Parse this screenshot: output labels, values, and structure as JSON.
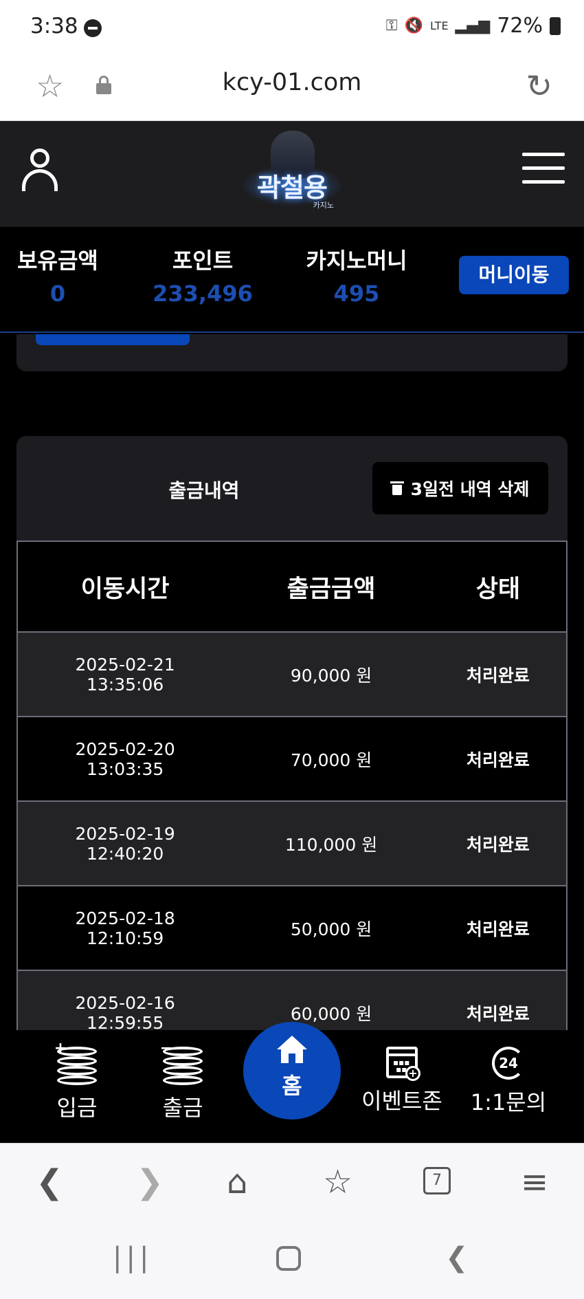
{
  "statusbar": {
    "time": "3:38",
    "battery": "72%",
    "lte": "LTE"
  },
  "browser": {
    "url": "kcy-01.com",
    "tab_count": "7"
  },
  "header": {
    "logo_text": "곽철용",
    "logo_sub": "카지노"
  },
  "balance": {
    "held_label": "보유금액",
    "held_value": "0",
    "points_label": "포인트",
    "points_value": "233,496",
    "casino_label": "카지노머니",
    "casino_value": "495",
    "transfer_button": "머니이동"
  },
  "history": {
    "title": "출금내역",
    "delete_button": "3일전 내역 삭제",
    "columns": [
      "이동시간",
      "출금금액",
      "상태"
    ],
    "rows": [
      {
        "date": "2025-02-21",
        "time": "13:35:06",
        "amount": "90,000 원",
        "status": "처리완료"
      },
      {
        "date": "2025-02-20",
        "time": "13:03:35",
        "amount": "70,000 원",
        "status": "처리완료"
      },
      {
        "date": "2025-02-19",
        "time": "12:40:20",
        "amount": "110,000 원",
        "status": "처리완료"
      },
      {
        "date": "2025-02-18",
        "time": "12:10:59",
        "amount": "50,000 원",
        "status": "처리완료"
      },
      {
        "date": "2025-02-16",
        "time": "12:59:55",
        "amount": "60,000 원",
        "status": "처리완료"
      }
    ]
  },
  "bottomnav": {
    "deposit": "입금",
    "withdraw": "출금",
    "home": "홈",
    "events": "이벤트존",
    "inquiry": "1:1문의",
    "inquiry_icon": "24"
  },
  "colors": {
    "accent": "#0a47b8",
    "success": "#3fae49",
    "header_bg": "#1d1d1f"
  }
}
